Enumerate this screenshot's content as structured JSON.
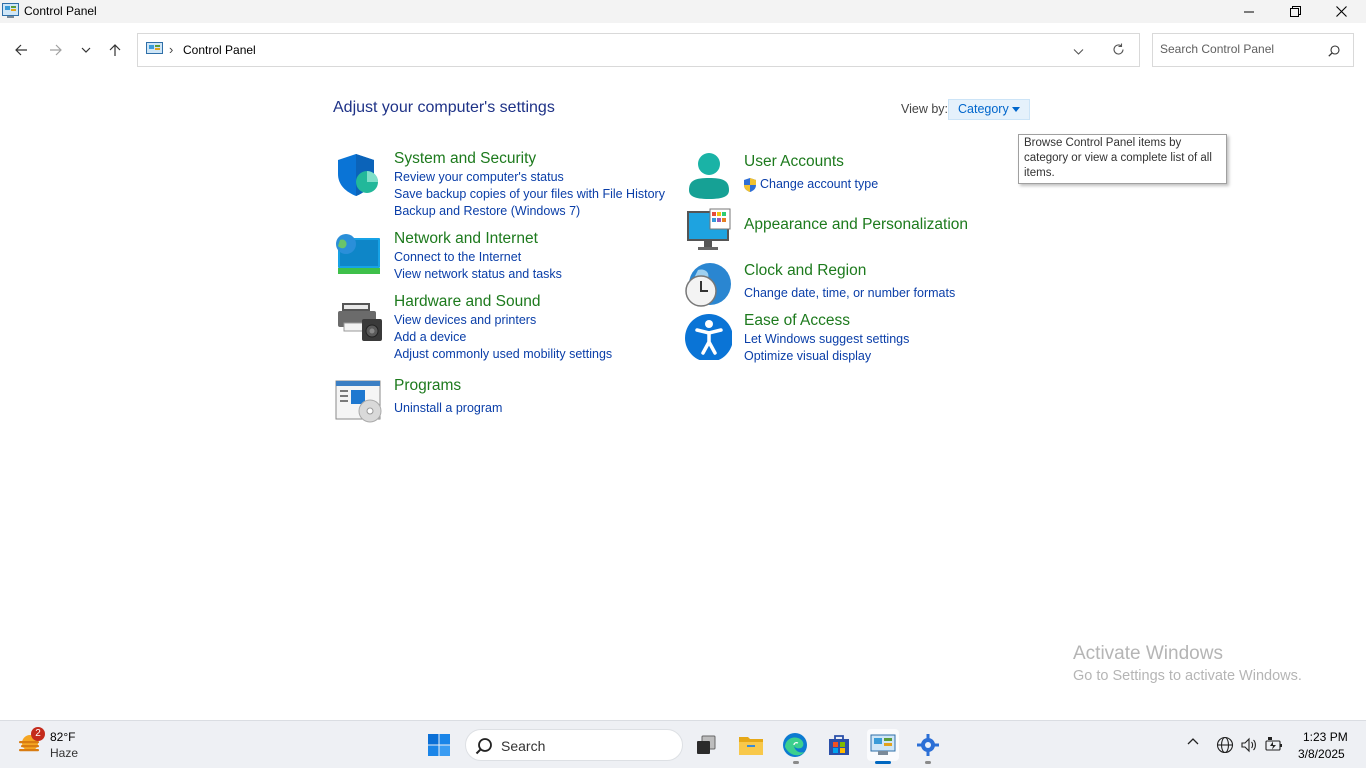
{
  "window": {
    "title": "Control Panel",
    "controls": {
      "minimize": "minimize",
      "maximize": "restore",
      "close": "close"
    }
  },
  "address": {
    "breadcrumb": "Control Panel",
    "search_placeholder": "Search Control Panel"
  },
  "main": {
    "heading": "Adjust your computer's settings",
    "view_by_label": "View by:",
    "view_by_value": "Category",
    "tooltip": "Browse Control Panel items by category or view a complete list of all items.",
    "left_categories": [
      {
        "title": "System and Security",
        "icon": "shield-icon",
        "links": [
          "Review your computer's status",
          "Save backup copies of your files with File History",
          "Backup and Restore (Windows 7)"
        ]
      },
      {
        "title": "Network and Internet",
        "icon": "network-globe-icon",
        "links": [
          "Connect to the Internet",
          "View network status and tasks"
        ]
      },
      {
        "title": "Hardware and Sound",
        "icon": "printer-speaker-icon",
        "links": [
          "View devices and printers",
          "Add a device",
          "Adjust commonly used mobility settings"
        ]
      },
      {
        "title": "Programs",
        "icon": "programs-disc-icon",
        "links": [
          "Uninstall a program"
        ]
      }
    ],
    "right_categories": [
      {
        "title": "User Accounts",
        "icon": "user-icon",
        "links": [
          "Change account type"
        ]
      },
      {
        "title": "Appearance and Personalization",
        "icon": "monitor-palette-icon",
        "links": []
      },
      {
        "title": "Clock and Region",
        "icon": "clock-globe-icon",
        "links": [
          "Change date, time, or number formats"
        ]
      },
      {
        "title": "Ease of Access",
        "icon": "accessibility-icon",
        "links": [
          "Let Windows suggest settings",
          "Optimize visual display"
        ]
      }
    ]
  },
  "watermark": {
    "line1": "Activate Windows",
    "line2": "Go to Settings to activate Windows."
  },
  "taskbar": {
    "weather_badge": "2",
    "weather_temp": "82°F",
    "weather_desc": "Haze",
    "search_label": "Search",
    "time": "1:23 PM",
    "date": "3/8/2025",
    "accent": "#0067c0"
  }
}
